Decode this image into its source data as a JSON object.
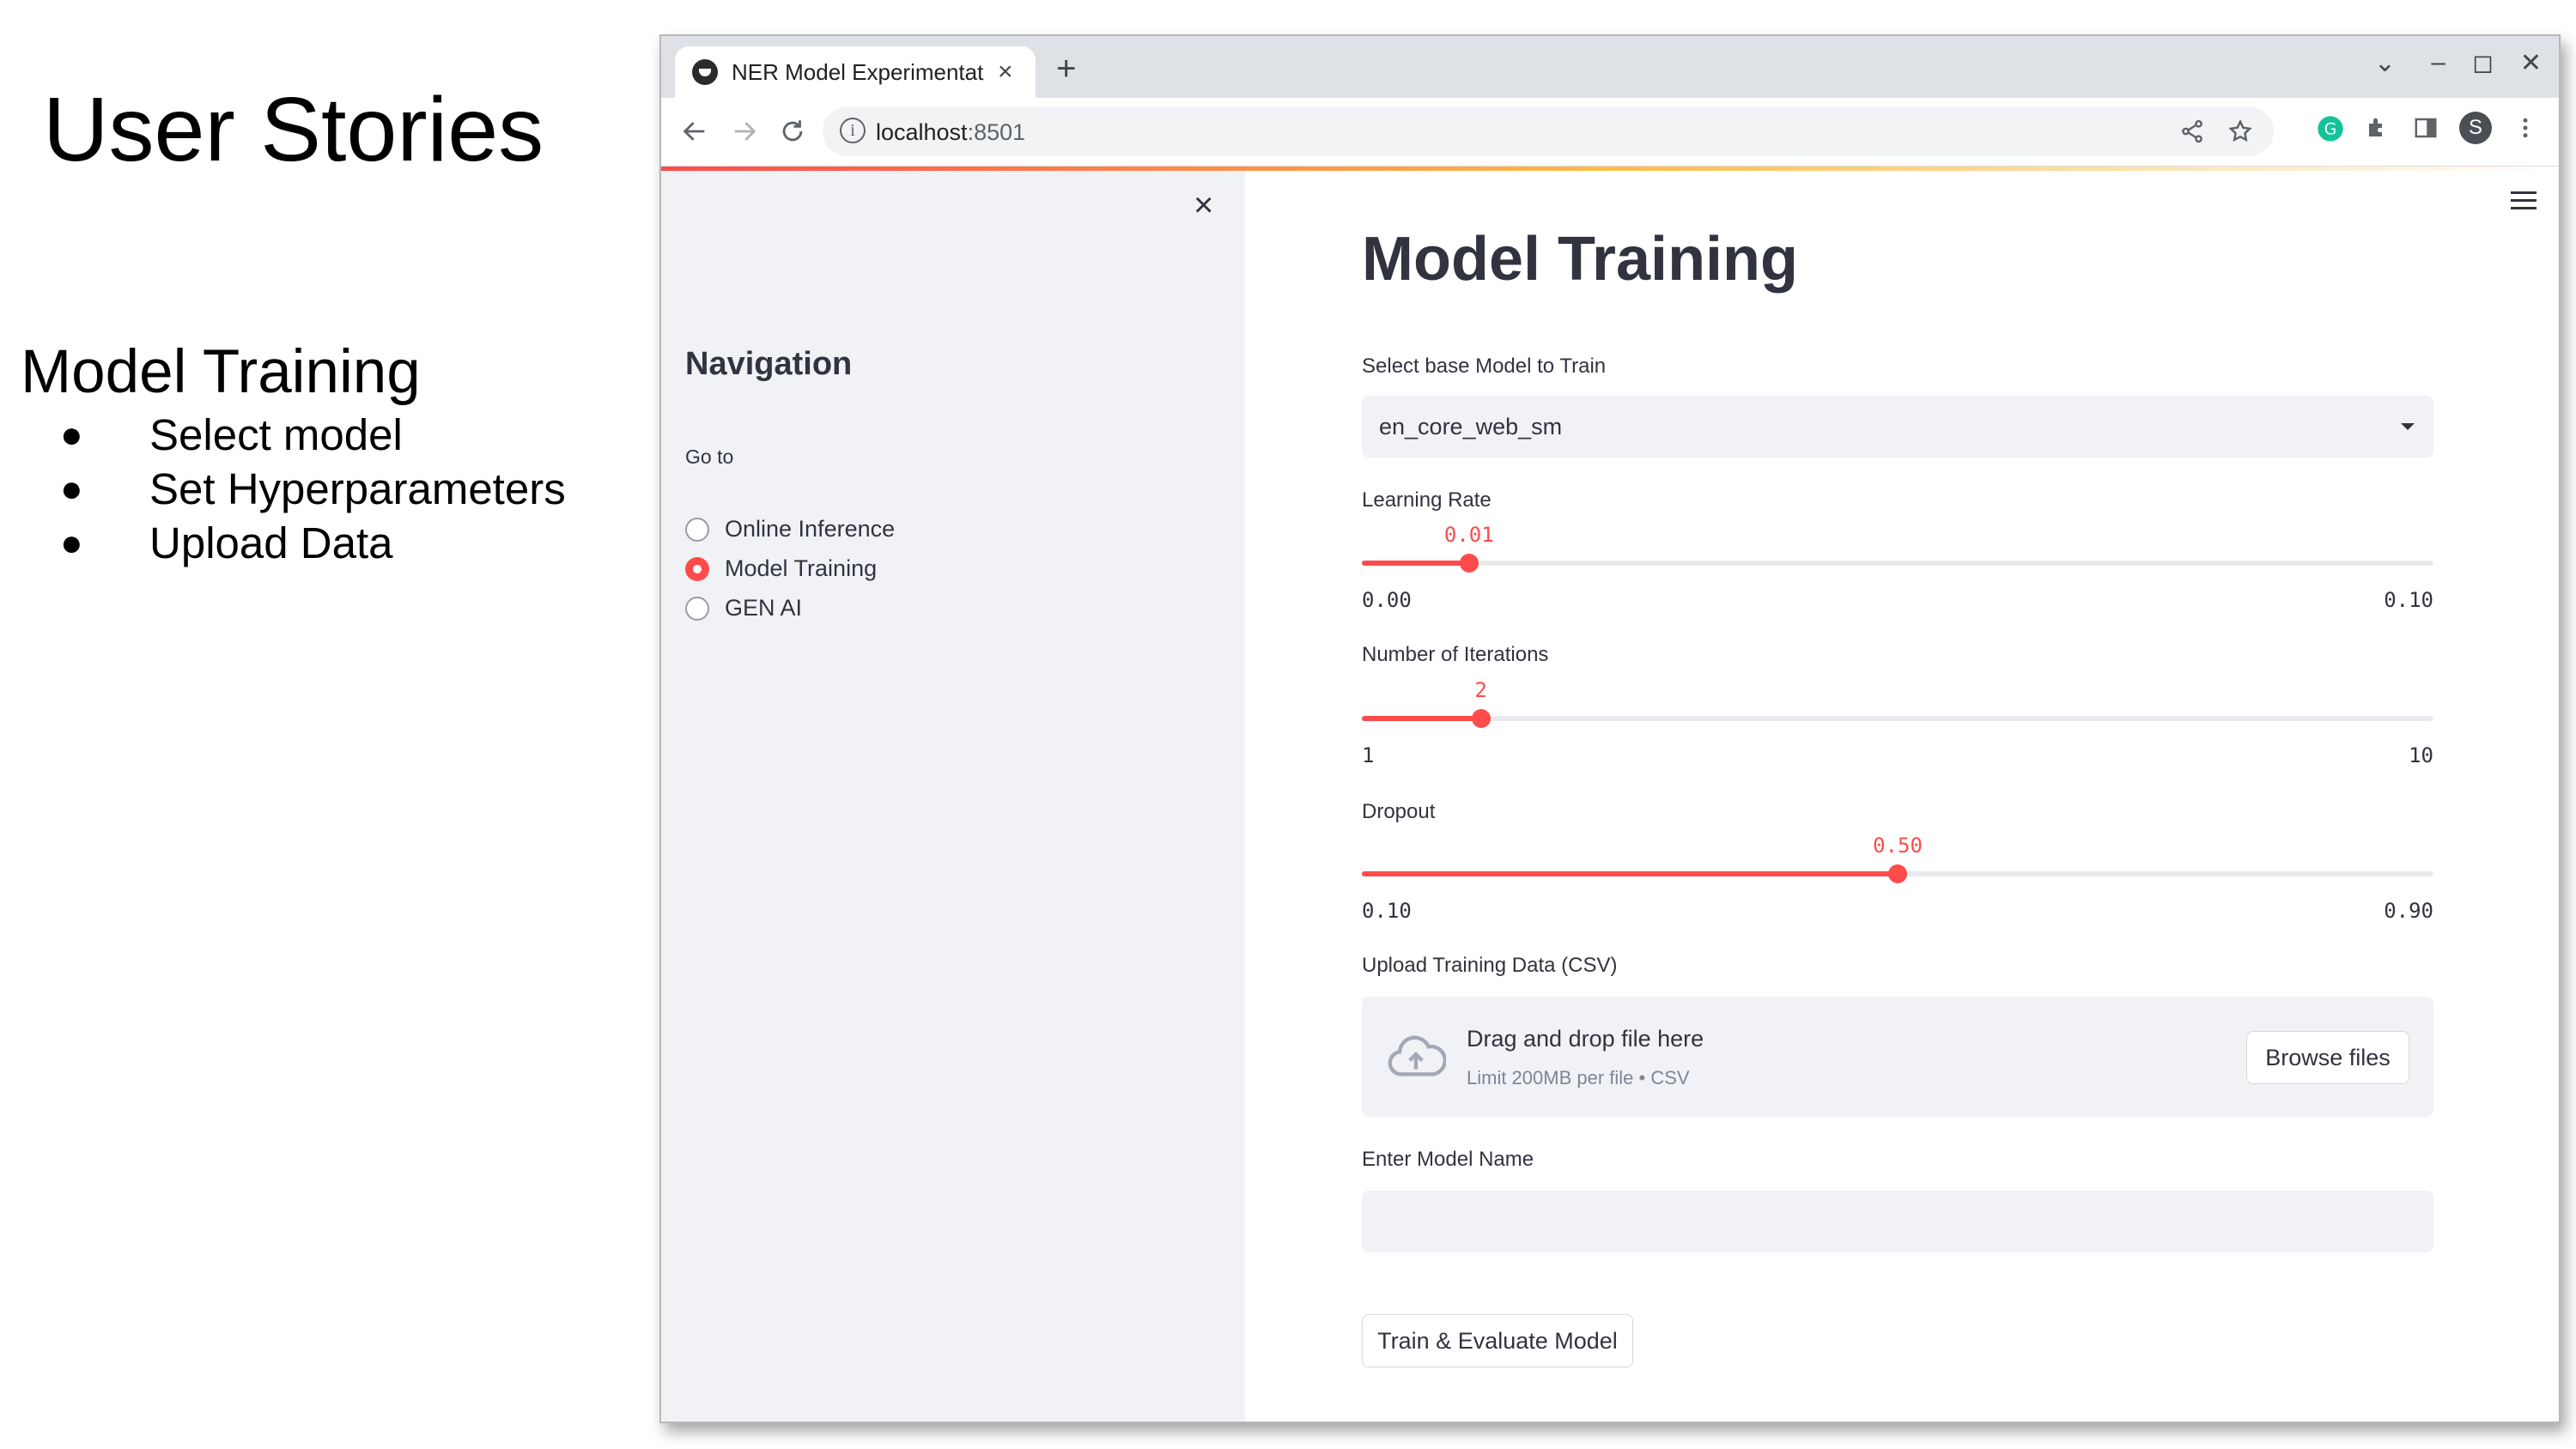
{
  "slide": {
    "title": "User Stories",
    "subtitle": "Model Training",
    "bullets": [
      "Select model",
      "Set Hyperparameters",
      "Upload Data"
    ],
    "bullet_glyph": "●"
  },
  "browser": {
    "tab_title": "NER Model Experimentat",
    "tab_close": "×",
    "new_tab": "+",
    "url_host": "localhost",
    "url_port": ":8501",
    "window_controls": [
      "⌄",
      "–",
      "◻",
      "✕"
    ],
    "profile_initial": "S",
    "accent_color": "#ff4b4b"
  },
  "sidebar": {
    "close": "×",
    "heading": "Navigation",
    "goto_label": "Go to",
    "options": [
      {
        "label": "Online Inference",
        "selected": false
      },
      {
        "label": "Model Training",
        "selected": true
      },
      {
        "label": "GEN AI",
        "selected": false
      }
    ]
  },
  "main": {
    "title": "Model Training",
    "base_model_label": "Select base Model to Train",
    "base_model_value": "en_core_web_sm",
    "sliders": [
      {
        "label": "Learning Rate",
        "value": 0.01,
        "value_text": "0.01",
        "min": 0.0,
        "max": 0.1,
        "min_text": "0.00",
        "max_text": "0.10"
      },
      {
        "label": "Number of Iterations",
        "value": 2,
        "value_text": "2",
        "min": 1,
        "max": 10,
        "min_text": "1",
        "max_text": "10"
      },
      {
        "label": "Dropout",
        "value": 0.5,
        "value_text": "0.50",
        "min": 0.1,
        "max": 0.9,
        "min_text": "0.10",
        "max_text": "0.90"
      }
    ],
    "upload_label": "Upload Training Data (CSV)",
    "upload_drag_text": "Drag and drop file here",
    "upload_limit_text": "Limit 200MB per file • CSV",
    "browse_button": "Browse files",
    "model_name_label": "Enter Model Name",
    "model_name_value": "",
    "train_button": "Train & Evaluate Model"
  }
}
